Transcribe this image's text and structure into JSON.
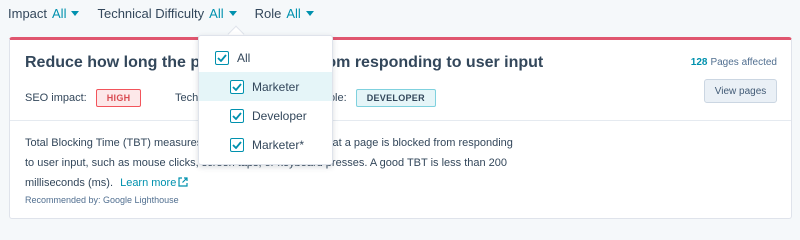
{
  "filters": [
    {
      "label": "Impact",
      "value": "All"
    },
    {
      "label": "Technical Difficulty",
      "value": "All"
    },
    {
      "label": "Role",
      "value": "All"
    }
  ],
  "card": {
    "title": "Reduce how long the page is blocked from responding to user input",
    "affected_count": "128",
    "affected_label": "Pages affected",
    "view_button": "View pages",
    "seo_label": "SEO impact:",
    "seo_value": "HIGH",
    "tech_label": "Technical difficulty:",
    "role_label": "Role:",
    "role_value": "DEVELOPER",
    "description": "Total Blocking Time (TBT) measures the total amount of time that a page is blocked from responding to user input, such as mouse clicks, screen taps, or keyboard presses. A good TBT is less than 200 milliseconds (ms).",
    "learn_more": "Learn more",
    "recommended_by": "Recommended by: Google Lighthouse"
  },
  "role_dropdown": {
    "options": [
      {
        "label": "All",
        "checked": true
      },
      {
        "label": "Marketer",
        "checked": true
      },
      {
        "label": "Developer",
        "checked": true
      },
      {
        "label": "Marketer*",
        "checked": true
      }
    ]
  },
  "colors": {
    "accent": "#0091ae",
    "alert": "#e0566f"
  }
}
